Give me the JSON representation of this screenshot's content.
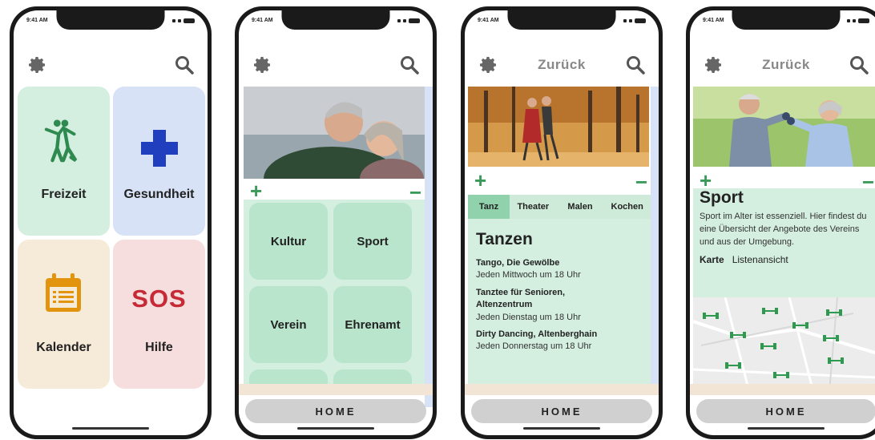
{
  "status_time": "9:41 AM",
  "colors": {
    "green_tile": "#d4efe0",
    "blue_tile": "#d7e2f7",
    "beige_tile": "#f6ead9",
    "pink_tile": "#f6dede",
    "accent_green": "#3a9a5a",
    "cross_blue": "#1f3fbf",
    "sos_red": "#c52a36",
    "calendar_orange": "#e3940f"
  },
  "screen1": {
    "tiles": [
      {
        "label": "Freizeit",
        "icon": "dancing-couple-icon"
      },
      {
        "label": "Gesundheit",
        "icon": "medical-cross-icon"
      },
      {
        "label": "Kalender",
        "icon": "calendar-icon"
      },
      {
        "label": "Hilfe",
        "icon": "sos-icon",
        "badge": "SOS"
      }
    ]
  },
  "screen2": {
    "plus": "+",
    "minus": "−",
    "categories": [
      "Kultur",
      "Sport",
      "Verein",
      "Ehrenamt"
    ],
    "home_label": "HOME"
  },
  "screen3": {
    "back_label": "Zurück",
    "plus": "+",
    "minus": "−",
    "tabs": [
      "Tanz",
      "Theater",
      "Malen",
      "Kochen"
    ],
    "heading": "Tanzen",
    "events": [
      {
        "title": "Tango, Die Gewölbe",
        "time": "Jeden Mittwoch um 18 Uhr"
      },
      {
        "title": "Tanztee für Senioren, Altenzentrum",
        "time": "Jeden Dienstag um 18 Uhr"
      },
      {
        "title": "Dirty Dancing, Altenberghain",
        "time": "Jeden Donnerstag um 18 Uhr"
      }
    ],
    "home_label": "HOME"
  },
  "screen4": {
    "back_label": "Zurück",
    "plus": "+",
    "minus": "−",
    "heading": "Sport",
    "description": "Sport im Alter ist essenziell. Hier findest du eine Übersicht der Angebote des Vereins und aus der Umgebung.",
    "view_tabs": [
      "Karte",
      "Listenansicht"
    ],
    "home_label": "HOME"
  }
}
